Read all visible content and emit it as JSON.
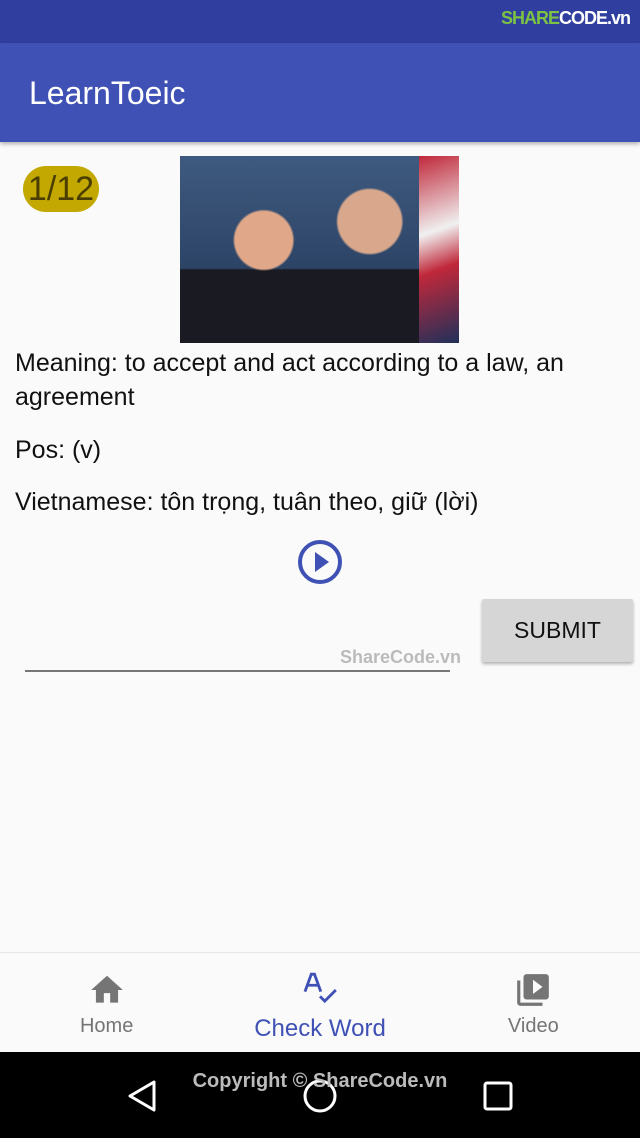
{
  "watermark": {
    "logo": "SHARECODE.vn",
    "logo_highlight": "SHARE",
    "logo_rest": "CODE.vn",
    "input_overlay": "ShareCode.vn",
    "copyright": "Copyright © ShareCode.vn"
  },
  "appbar": {
    "title": "LearnToeic"
  },
  "card": {
    "counter": "1/12",
    "meaning": "Meaning: to accept and act according to a law, an agreement",
    "pos": "Pos: (v)",
    "vietnamese": "Vietnamese: tôn trọng, tuân theo, giữ (lời)",
    "play_icon": "play-circle-icon"
  },
  "answer": {
    "value": "",
    "placeholder": ""
  },
  "submit_label": "SUBMIT",
  "bottom_nav": {
    "items": [
      {
        "label": "Home",
        "icon": "home-icon"
      },
      {
        "label": "Check Word",
        "icon": "spellcheck-icon",
        "active": true
      },
      {
        "label": "Video",
        "icon": "video-library-icon"
      }
    ]
  },
  "colors": {
    "primary": "#3f51b5",
    "primary_dark": "#303f9f",
    "counter_bg": "#c2a800"
  }
}
